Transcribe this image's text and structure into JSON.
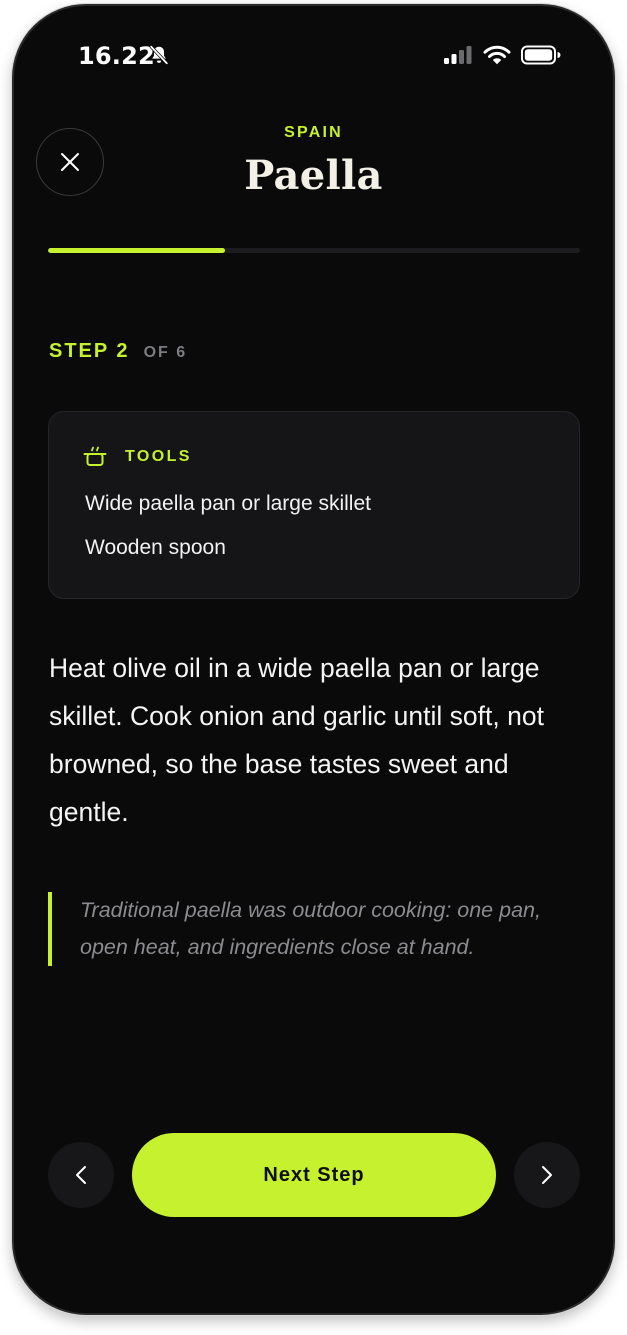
{
  "status_bar": {
    "time": "16.22",
    "icons": [
      "bell-slash-icon",
      "cellular-signal-icon",
      "wifi-icon",
      "battery-icon"
    ]
  },
  "header": {
    "close_icon": "close-icon",
    "country": "SPAIN",
    "title": "Paella",
    "progress": {
      "current": 2,
      "total": 6,
      "fraction": 0.333
    }
  },
  "step": {
    "label": "STEP 2",
    "of_label": "OF 6"
  },
  "tools": {
    "icon": "pot-icon",
    "label": "TOOLS",
    "items": [
      "Wide paella pan or large skillet",
      "Wooden spoon"
    ]
  },
  "instruction": "Heat olive oil in a wide paella pan or large skillet. Cook onion and garlic until soft, not browned, so the base tastes sweet and gentle.",
  "tip": "Traditional paella was outdoor cooking: one pan, open heat, and ingredients close at hand.",
  "navigation": {
    "prev_icon": "chevron-left-icon",
    "next_icon": "chevron-right-icon",
    "next_step_label": "Next Step"
  },
  "colors": {
    "accent": "#c6f12e",
    "background": "#0a0a0b",
    "card": "#151518",
    "muted": "#8b8b90"
  }
}
